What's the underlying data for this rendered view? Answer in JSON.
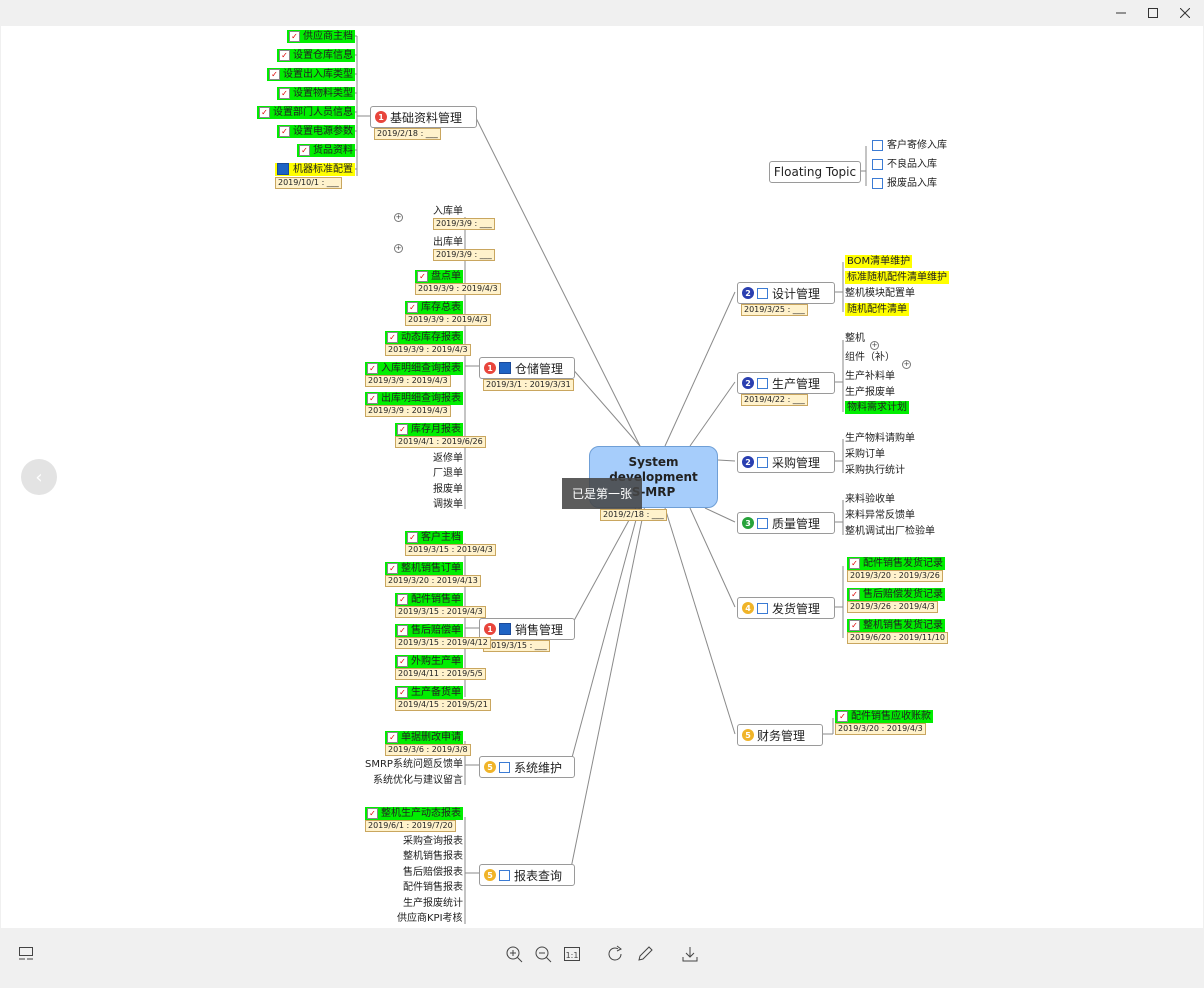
{
  "toast": "已是第一张",
  "center": {
    "lines": [
      "System",
      "development",
      "S-MRP"
    ],
    "date": "2019/2/18 : ___"
  },
  "floating": {
    "label": "Floating Topic",
    "items": [
      "客户寄修入库",
      "不良品入库",
      "报废品入库"
    ]
  },
  "branches": {
    "jichu": {
      "label": "基础资料管理",
      "num": "1",
      "date": "2019/2/18 : ___"
    },
    "cangchu": {
      "label": "仓储管理",
      "num": "1",
      "date": "2019/3/1 : 2019/3/31"
    },
    "xiaoshou": {
      "label": "销售管理",
      "num": "1",
      "date": "2019/3/15 : ___"
    },
    "xitong": {
      "label": "系统维护",
      "num": "5"
    },
    "baobiao": {
      "label": "报表查询",
      "num": "5"
    },
    "sheji": {
      "label": "设计管理",
      "num": "2",
      "date": "2019/3/25 : ___"
    },
    "shengchan": {
      "label": "生产管理",
      "num": "2",
      "date": "2019/4/22 : ___"
    },
    "caigou": {
      "label": "采购管理",
      "num": "2"
    },
    "zhiliang": {
      "label": "质量管理",
      "num": "3"
    },
    "fahuo": {
      "label": "发货管理",
      "num": "4"
    },
    "caiwu": {
      "label": "财务管理",
      "num": "5"
    }
  },
  "jichu_items": [
    {
      "text": "供应商主档",
      "style": "g"
    },
    {
      "text": "设置仓库信息",
      "style": "g"
    },
    {
      "text": "设置出入库类型",
      "style": "g"
    },
    {
      "text": "设置物料类型",
      "style": "g"
    },
    {
      "text": "设置部门人员信息",
      "style": "g"
    },
    {
      "text": "设置电源参数",
      "style": "g"
    },
    {
      "text": "货品资料",
      "style": "g"
    },
    {
      "text": "机器标准配置",
      "style": "y",
      "date": "2019/10/1 : ___"
    }
  ],
  "cangchu_items": [
    {
      "text": "入库单",
      "date": "2019/3/9 : ___"
    },
    {
      "text": "出库单",
      "date": "2019/3/9 : ___"
    },
    {
      "text": "盘点单",
      "date": "2019/3/9 : 2019/4/3"
    },
    {
      "text": "库存总表",
      "date": "2019/3/9 : 2019/4/3"
    },
    {
      "text": "动态库存报表",
      "date": "2019/3/9 : 2019/4/3"
    },
    {
      "text": "入库明细查询报表",
      "date": "2019/3/9 : 2019/4/3"
    },
    {
      "text": "出库明细查询报表",
      "date": "2019/3/9 : 2019/4/3"
    },
    {
      "text": "库存月报表",
      "date": "2019/4/1 : 2019/6/26"
    },
    {
      "text": "返修单"
    },
    {
      "text": "厂退单"
    },
    {
      "text": "报废单"
    },
    {
      "text": "调拨单"
    }
  ],
  "xiaoshou_items": [
    {
      "text": "客户主档",
      "date": "2019/3/15 : 2019/4/3"
    },
    {
      "text": "整机销售订单",
      "date": "2019/3/20 : 2019/4/13"
    },
    {
      "text": "配件销售单",
      "date": "2019/3/15 : 2019/4/3"
    },
    {
      "text": "售后赔偿单",
      "date": "2019/3/15 : 2019/4/12"
    },
    {
      "text": "外购生产单",
      "date": "2019/4/11 : 2019/5/5"
    },
    {
      "text": "生产备货单",
      "date": "2019/4/15 : 2019/5/21"
    }
  ],
  "xitong_items": [
    {
      "text": "单据删改申请",
      "date": "2019/3/6 : 2019/3/8"
    },
    {
      "text": "SMRP系统问题反馈单"
    },
    {
      "text": "系统优化与建议留言"
    }
  ],
  "baobiao_items": [
    {
      "text": "整机生产动态报表",
      "date": "2019/6/1 : 2019/7/20"
    },
    {
      "text": "采购查询报表"
    },
    {
      "text": "整机销售报表"
    },
    {
      "text": "售后赔偿报表"
    },
    {
      "text": "配件销售报表"
    },
    {
      "text": "生产报废统计"
    },
    {
      "text": "供应商KPI考核"
    }
  ],
  "sheji_items": [
    "BOM清单维护",
    "标准随机配件清单维护",
    "整机模块配置单",
    "随机配件清单"
  ],
  "shengchan_items": [
    "整机",
    "组件（补）",
    "生产补料单",
    "生产报废单",
    "物料需求计划"
  ],
  "caigou_items": [
    "生产物料请购单",
    "采购订单",
    "采购执行统计"
  ],
  "zhiliang_items": [
    "来料验收单",
    "来料异常反馈单",
    "整机调试出厂检验单"
  ],
  "fahuo_items": [
    {
      "text": "配件销售发货记录",
      "date": "2019/3/20 : 2019/3/26"
    },
    {
      "text": "售后赔偿发货记录",
      "date": "2019/3/26 : 2019/4/3"
    },
    {
      "text": "整机销售发货记录",
      "date": "2019/6/20 : 2019/11/10"
    }
  ],
  "caiwu_items": [
    {
      "text": "配件销售应收账款",
      "date": "2019/3/20 : 2019/4/3"
    }
  ],
  "colors": {
    "green": "#00ee00",
    "yellow": "#ffff00",
    "center": "#a6cdfb",
    "num1": "#e8453c",
    "num2": "#2a3fb0",
    "num3": "#27a33b",
    "num4": "#f0b429",
    "num5": "#f0b429"
  }
}
